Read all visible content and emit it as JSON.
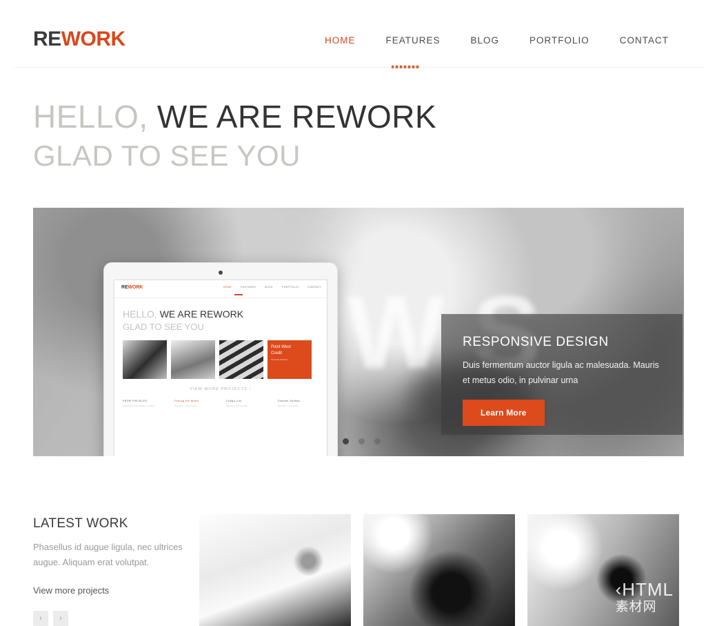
{
  "brand": {
    "part1": "RE",
    "part2": "WORK",
    "accent_color": "#d8481c"
  },
  "nav": {
    "items": [
      {
        "label": "HOME",
        "active": true
      },
      {
        "label": "FEATURES",
        "active": false
      },
      {
        "label": "BLOG",
        "active": false
      },
      {
        "label": "PORTFOLIO",
        "active": false
      },
      {
        "label": "CONTACT",
        "active": false
      }
    ]
  },
  "hero": {
    "line1_light": "HELLO,",
    "line1_dark": "WE ARE REWORK",
    "line2": "GLAD TO SEE YOU"
  },
  "slider": {
    "background_letters": "NEWS",
    "caption": {
      "title": "RESPONSIVE DESIGN",
      "text": "Duis fermentum auctor ligula ac malesuada. Mauris et metus odio, in pulvinar urna",
      "button": "Learn More",
      "button_color": "#dd4a1b"
    },
    "dots": [
      {
        "active": true
      },
      {
        "active": false
      },
      {
        "active": false
      }
    ],
    "tablet": {
      "logo_part1": "RE",
      "logo_part2": "WORK",
      "nav": [
        "HOME",
        "FEATURES",
        "BLOG",
        "PORTFOLIO",
        "CONTACT"
      ],
      "hero_light": "HELLO,",
      "hero_dark": "WE ARE REWORK",
      "hero_line2": "GLAD TO SEE YOU",
      "thumb_label": "Point West",
      "thumb_label2": "Credit",
      "thumb_sub": "Financial Services",
      "view_more": "VIEW MORE PROJECTS ›",
      "blog_heading": "FROM THE BLOG:",
      "blog_posts": [
        {
          "title": "Feeling the Wrath",
          "meta": "May 2013 · 12 Comments",
          "highlight": true
        },
        {
          "title": "Craig's List",
          "meta": "May 2013 · 8 Comments",
          "highlight": false
        },
        {
          "title": "Summer Sounds",
          "meta": "Apr 2013 · 5 Comments",
          "highlight": false
        }
      ]
    }
  },
  "latest_work": {
    "title": "LATEST WORK",
    "description": "Phasellus id augue ligula, nec ultrices augue. Aliquam erat volutpat.",
    "link": "View more projects",
    "prev": "‹",
    "next": "›"
  },
  "watermark": {
    "text": "‹HTML",
    "sub": "素材网"
  }
}
